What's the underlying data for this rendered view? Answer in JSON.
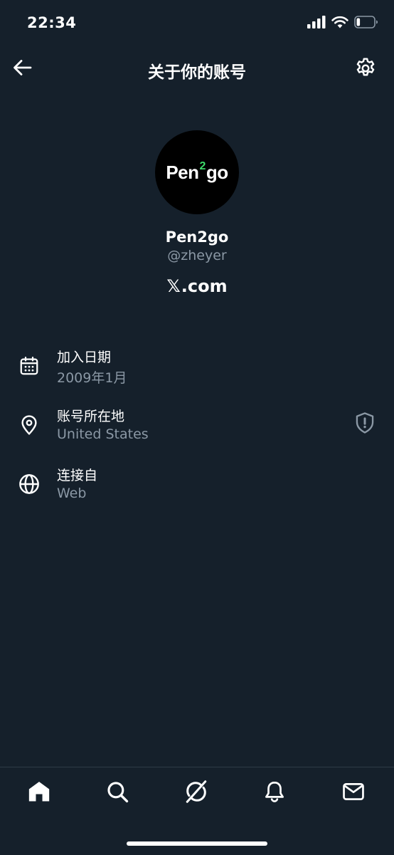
{
  "status_bar": {
    "time": "22:34",
    "icons": [
      "cellular-signal-icon",
      "wifi-icon",
      "battery-icon"
    ],
    "battery_level": 0.2
  },
  "header": {
    "title": "关于你的账号",
    "back_icon": "back-arrow-icon",
    "settings_icon": "gear-icon"
  },
  "profile": {
    "avatar_text_before": "Pen",
    "avatar_text_super": "2",
    "avatar_text_after": "go",
    "display_name": "Pen2go",
    "handle": "@zheyer",
    "site_prefix": "𝕏",
    "site_suffix": ".com"
  },
  "info": [
    {
      "icon": "calendar-icon",
      "label": "加入日期",
      "value": "2009年1月"
    },
    {
      "icon": "location-pin-icon",
      "label": "账号所在地",
      "value": "United States",
      "action_icon": "shield-alert-icon"
    },
    {
      "icon": "globe-icon",
      "label": "连接自",
      "value": "Web"
    }
  ],
  "tab_bar": {
    "tabs": [
      "home-icon",
      "search-icon",
      "grok-icon",
      "notifications-bell-icon",
      "messages-envelope-icon"
    ],
    "active": "home-icon"
  },
  "colors": {
    "background": "#15202b",
    "primary_text": "#ffffff",
    "secondary_text": "#8b98a5",
    "avatar_accent": "#3ddc6a"
  }
}
